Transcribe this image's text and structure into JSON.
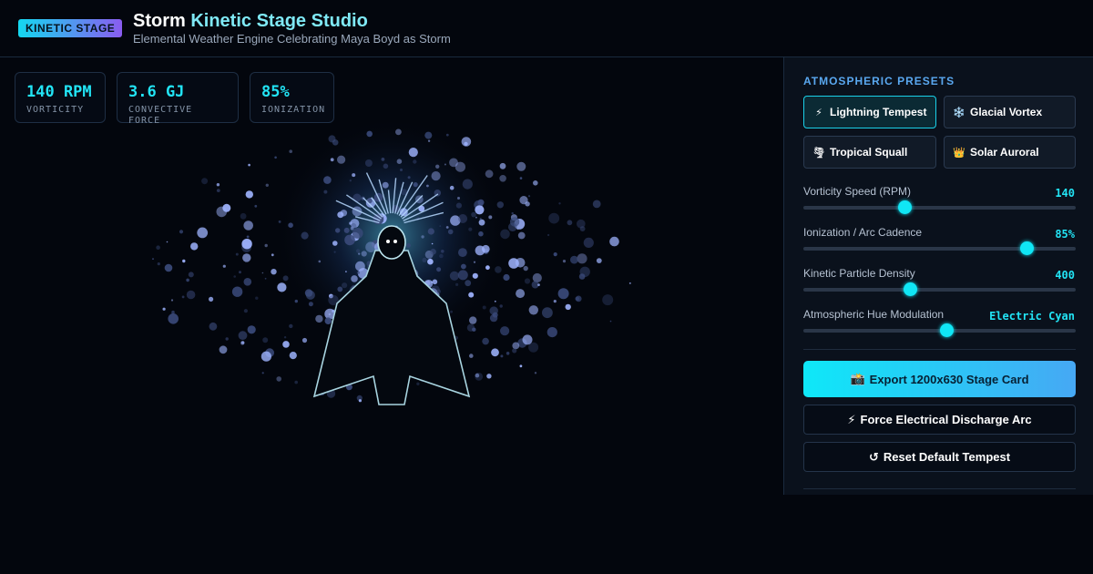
{
  "header": {
    "badge": "KINETIC STAGE",
    "title_part1": "Storm ",
    "title_part2": "Kinetic Stage Studio",
    "subtitle": "Elemental Weather Engine Celebrating Maya Boyd as Storm"
  },
  "stats": [
    {
      "value": "140 RPM",
      "label": "VORTICITY"
    },
    {
      "value": "3.6 GJ",
      "label": "CONVECTIVE FORCE"
    },
    {
      "value": "85%",
      "label": "IONIZATION"
    }
  ],
  "panel": {
    "section_title": "ATMOSPHERIC PRESETS",
    "presets": [
      {
        "icon": "⚡",
        "label": "Lightning Tempest",
        "active": true
      },
      {
        "icon": "❄️",
        "label": "Glacial Vortex",
        "active": false
      },
      {
        "icon": "🌪",
        "label": "Tropical Squall",
        "active": false
      },
      {
        "icon": "👑",
        "label": "Solar Auroral",
        "active": false
      }
    ],
    "sliders": [
      {
        "label": "Vorticity Speed (RPM)",
        "value": "140",
        "fraction": 0.37
      },
      {
        "label": "Ionization / Arc Cadence",
        "value": "85%",
        "fraction": 0.818
      },
      {
        "label": "Kinetic Particle Density",
        "value": "400",
        "fraction": 0.392
      },
      {
        "label": "Atmospheric Hue Modulation",
        "value": "Electric Cyan",
        "fraction": 0.525
      }
    ],
    "export_icon": "📸",
    "export_label": "Export 1200x630 Stage Card",
    "discharge_icon": "⚡",
    "discharge_label": "Force Electrical Discharge Arc",
    "reset_icon": "↺",
    "reset_label": "Reset Default Tempest"
  },
  "colors": {
    "accent": "#22e4f5",
    "particle_light": "#9fb4ff",
    "particle_dark": "#3a4a7a"
  }
}
